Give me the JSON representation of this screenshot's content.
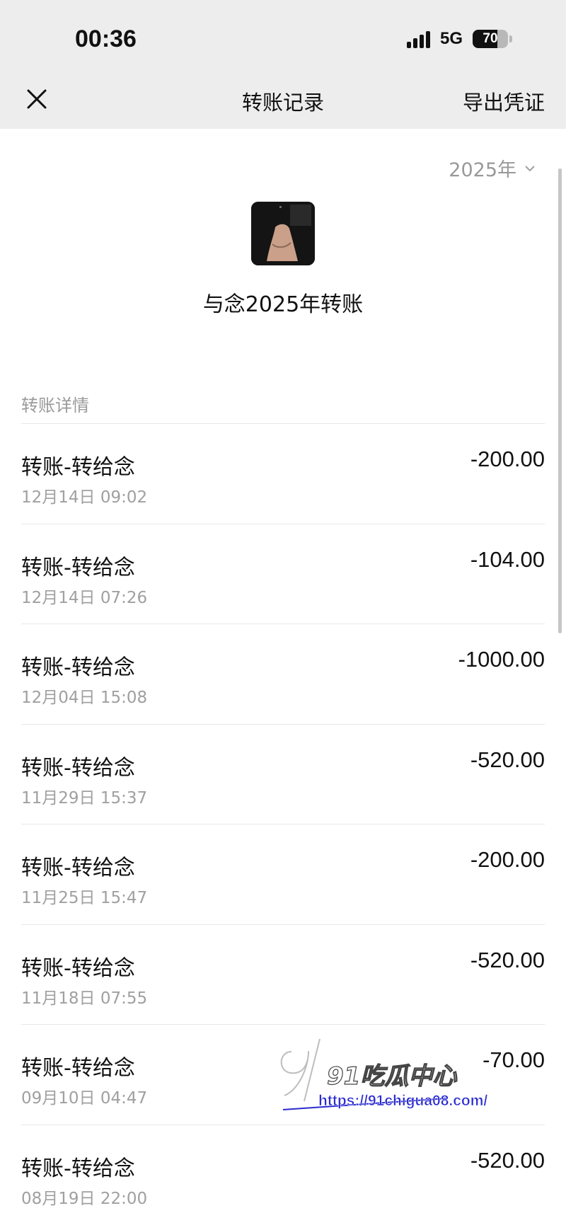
{
  "status_bar": {
    "time": "00:36",
    "network": "5G",
    "battery_text": "70",
    "battery_level": 0.7
  },
  "nav": {
    "close_icon": "close-icon",
    "title": "转账记录",
    "export_label": "导出凭证"
  },
  "filter": {
    "year_label": "2025年",
    "chevron_icon": "chevron-down-icon"
  },
  "summary": {
    "title": "与念2025年转账"
  },
  "section_label": "转账详情",
  "records": [
    {
      "title": "转账-转给念",
      "time": "12月14日 09:02",
      "amount": "-200.00"
    },
    {
      "title": "转账-转给念",
      "time": "12月14日 07:26",
      "amount": "-104.00"
    },
    {
      "title": "转账-转给念",
      "time": "12月04日 15:08",
      "amount": "-1000.00"
    },
    {
      "title": "转账-转给念",
      "time": "11月29日 15:37",
      "amount": "-520.00"
    },
    {
      "title": "转账-转给念",
      "time": "11月25日 15:47",
      "amount": "-200.00"
    },
    {
      "title": "转账-转给念",
      "time": "11月18日 07:55",
      "amount": "-520.00"
    },
    {
      "title": "转账-转给念",
      "time": "09月10日 04:47",
      "amount": "-70.00"
    },
    {
      "title": "转账-转给念",
      "time": "08月19日 22:00",
      "amount": "-520.00"
    }
  ],
  "watermark": {
    "brand": "91吃瓜中心",
    "url": "https://91chigua08.com/"
  }
}
